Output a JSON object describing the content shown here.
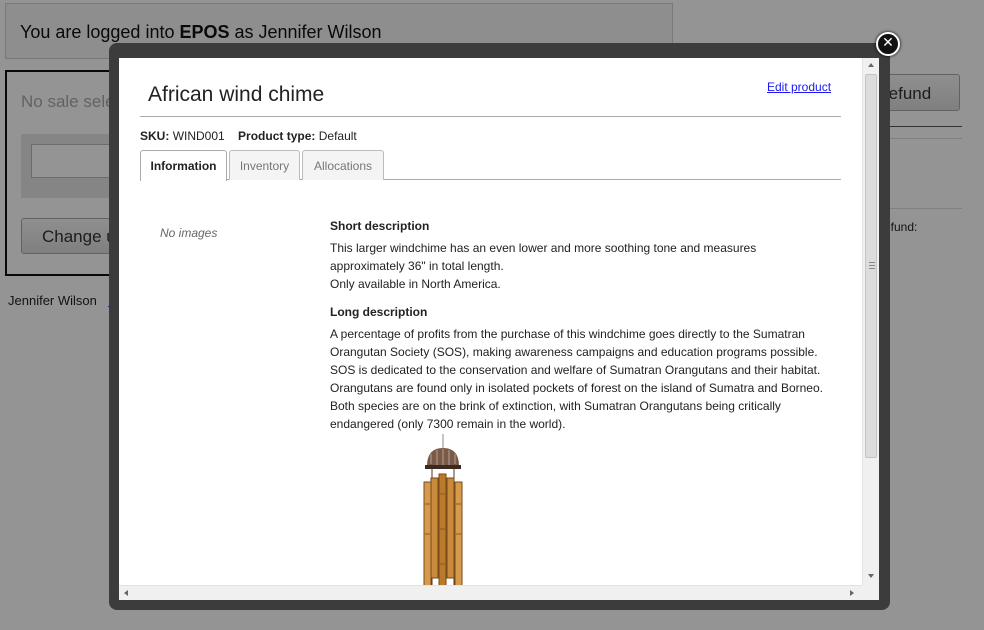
{
  "background": {
    "header": {
      "prefix": "You are logged into ",
      "app": "EPOS",
      "suffix": " as Jennifer Wilson"
    },
    "no_sale": "No sale sele",
    "change_button": "Change us",
    "user_name": "Jennifer Wilson",
    "user_link": "Lo",
    "refund_button": "refund",
    "refund_label": "refund:"
  },
  "modal": {
    "close_icon": "close-icon",
    "title": "African wind chime",
    "edit_link": "Edit product",
    "sku_label": "SKU:",
    "sku_value": "WIND001",
    "type_label": "Product type:",
    "type_value": "Default",
    "tabs": [
      {
        "label": "Information",
        "active": true
      },
      {
        "label": "Inventory",
        "active": false
      },
      {
        "label": "Allocations",
        "active": false
      }
    ],
    "no_images": "No images",
    "short_heading": "Short description",
    "short_lines": [
      "This larger windchime has an even lower and more soothing tone and measures approximately 36\" in total length.",
      "Only available in North America."
    ],
    "long_heading": "Long description",
    "long_text": "A percentage of profits from the purchase of this windchime goes directly to the Sumatran Orangutan Society (SOS), making awareness campaigns and education programs possible. SOS is dedicated to the conservation and welfare of Sumatran Orangutans and their habitat. Orangutans are found only in isolated pockets of forest on the island of Sumatra and Borneo. Both species are on the brink of extinction, with Sumatran Orangutans being critically endangered (only 7300 remain in the world)."
  },
  "colors": {
    "link": "#1a1aee",
    "modal_frame": "#3c3c3c",
    "overlay": "rgba(0,0,0,0.42)"
  }
}
